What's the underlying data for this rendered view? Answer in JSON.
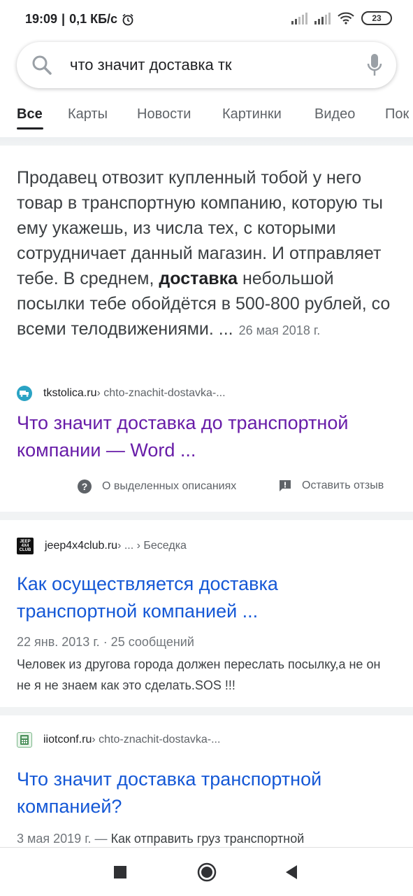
{
  "status_bar": {
    "time": "19:09",
    "speed": "0,1 КБ/с",
    "battery": "23"
  },
  "search": {
    "query": "что значит доставка тк"
  },
  "tabs": [
    "Все",
    "Карты",
    "Новости",
    "Картинки",
    "Видео",
    "Пок"
  ],
  "featured_snippet": {
    "text_before": "Продавец отвозит купленный тобой у него товар в транспортную компанию, которую ты ему укажешь, из числа тех, с которыми сотрудничает данный магазин. И отправляет тебе. В среднем, ",
    "bold": "доставка",
    "text_after": " небольшой посылки тебе обойдётся в 500-800 рублей, со всеми телодвижениями. ...",
    "date": "26 мая 2018 г.",
    "site": "tkstolica.ru",
    "path": " › chto-znachit-dostavka-...",
    "title": "Что значит доставка до транспортной компании — Word ...",
    "about_label": "О выделенных описаниях",
    "feedback_label": "Оставить отзыв"
  },
  "results": [
    {
      "site": "jeep4x4club.ru",
      "path": " › ... › Беседка",
      "favicon_text": "JEEP 4X4 CLUB",
      "title": "Как осуществляется доставка транспортной компанией ...",
      "meta": "22 янв. 2013 г. · 25 сообщений",
      "description": "Человек из другова города должен переслать посылку,а не он не я не знаем как это сделать.SOS !!!"
    },
    {
      "site": "iiotconf.ru",
      "path": " › chto-znachit-dostavka-...",
      "title": "Что значит доставка транспортной компанией?",
      "date": "3 мая 2019 г. — ",
      "description": "Как отправить груз транспортной"
    }
  ],
  "colors": {
    "visited_link": "#681da8",
    "link": "#1558d6",
    "separator": "#f1f3f4"
  }
}
